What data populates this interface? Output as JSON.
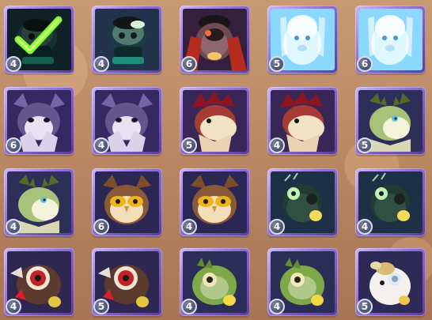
{
  "screen": {
    "grid": {
      "cards": [
        {
          "label": "4",
          "selected": true,
          "character": "dark-toad"
        },
        {
          "label": "4",
          "selected": false,
          "character": "dark-toad"
        },
        {
          "label": "6",
          "selected": false,
          "character": "fire-boar"
        },
        {
          "label": "5",
          "selected": false,
          "character": "ice-ghost"
        },
        {
          "label": "6",
          "selected": false,
          "character": "ice-ghost"
        },
        {
          "label": "6",
          "selected": false,
          "character": "shadow-beast"
        },
        {
          "label": "4",
          "selected": false,
          "character": "shadow-beast"
        },
        {
          "label": "5",
          "selected": false,
          "character": "red-dragon"
        },
        {
          "label": "4",
          "selected": false,
          "character": "red-dragon"
        },
        {
          "label": "5",
          "selected": false,
          "character": "forest-deer"
        },
        {
          "label": "4",
          "selected": false,
          "character": "forest-deer"
        },
        {
          "label": "6",
          "selected": false,
          "character": "great-owl"
        },
        {
          "label": "4",
          "selected": false,
          "character": "great-owl"
        },
        {
          "label": "4",
          "selected": false,
          "character": "green-cricket"
        },
        {
          "label": "4",
          "selected": false,
          "character": "green-cricket"
        },
        {
          "label": "4",
          "selected": false,
          "character": "brown-boar"
        },
        {
          "label": "5",
          "selected": false,
          "character": "brown-boar"
        },
        {
          "label": "4",
          "selected": false,
          "character": "moss-fish"
        },
        {
          "label": "4",
          "selected": false,
          "character": "moss-fish"
        },
        {
          "label": "5",
          "selected": false,
          "character": "white-hamster"
        }
      ]
    }
  }
}
